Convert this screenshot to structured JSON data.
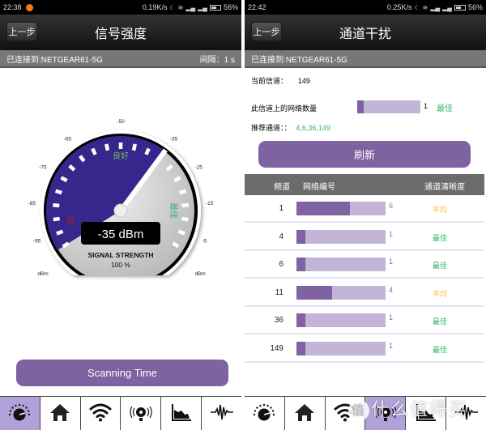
{
  "left": {
    "statusbar": {
      "time": "22:38",
      "speed": "0.19K/s",
      "battery": "56%"
    },
    "title": "信号强度",
    "back_label": "上一步",
    "connection": "已连接到:NETGEAR61-5G",
    "interval": "间隔：1 s",
    "gauge": {
      "value_dbm": -35,
      "readout": "-35 dBm",
      "caption": "SIGNAL STRENGTH",
      "percent": "100 %",
      "tick_labels": [
        "-95",
        "-85",
        "-75",
        "-65",
        "-50",
        "-35",
        "-25",
        "-15",
        "-5"
      ],
      "unit_left": "dBm",
      "unit_right": "dBm",
      "zone_weak": "弱",
      "zone_good": "良好",
      "zone_best": "最佳",
      "range": [
        -100,
        0
      ],
      "colors": {
        "filled": "#35278c",
        "empty": "#cfcfcf",
        "weak": "#b01c2e",
        "good": "#6fbf5a",
        "best": "#2fb36b"
      }
    },
    "scan_button": "Scanning Time",
    "tabs": [
      {
        "icon": "gauge-icon",
        "active": true
      },
      {
        "icon": "home-icon",
        "active": false
      },
      {
        "icon": "wifi-icon",
        "active": false
      },
      {
        "icon": "signal-broadcast-icon",
        "active": false
      },
      {
        "icon": "area-chart-icon",
        "active": false
      },
      {
        "icon": "waveform-icon",
        "active": false
      }
    ]
  },
  "right": {
    "statusbar": {
      "time": "22:42",
      "speed": "0.25K/s",
      "battery": "56%"
    },
    "title": "通道干扰",
    "back_label": "上一步",
    "connection": "已连接到:NETGEAR61-5G",
    "current_channel_label": "当前信道：",
    "current_channel": "149",
    "network_count_label": "此信道上的网络数量",
    "network_count": "1",
    "network_count_ratio": 0.1,
    "network_rating": "最佳",
    "recommended_label": "推荐通道：：",
    "recommended": "4,6,36,149",
    "refresh_button": "刷新",
    "table": {
      "headers": [
        "频道",
        "网络编号",
        "通道清晰度"
      ],
      "rows": [
        {
          "channel": "1",
          "count": "6",
          "ratio": 0.6,
          "clarity": "平均",
          "color": "#f5b82e"
        },
        {
          "channel": "4",
          "count": "1",
          "ratio": 0.1,
          "clarity": "最佳",
          "color": "#2fb36b"
        },
        {
          "channel": "6",
          "count": "1",
          "ratio": 0.1,
          "clarity": "最佳",
          "color": "#2fb36b"
        },
        {
          "channel": "11",
          "count": "4",
          "ratio": 0.4,
          "clarity": "平均",
          "color": "#f5b82e"
        },
        {
          "channel": "36",
          "count": "1",
          "ratio": 0.1,
          "clarity": "最佳",
          "color": "#2fb36b"
        },
        {
          "channel": "149",
          "count": "1",
          "ratio": 0.1,
          "clarity": "最佳",
          "color": "#2fb36b"
        }
      ]
    },
    "tabs": [
      {
        "icon": "gauge-icon",
        "active": false
      },
      {
        "icon": "home-icon",
        "active": false
      },
      {
        "icon": "wifi-icon",
        "active": false
      },
      {
        "icon": "signal-broadcast-icon",
        "active": true
      },
      {
        "icon": "area-chart-icon",
        "active": false
      },
      {
        "icon": "waveform-icon",
        "active": false
      }
    ],
    "watermark": "值 什么值得买"
  }
}
